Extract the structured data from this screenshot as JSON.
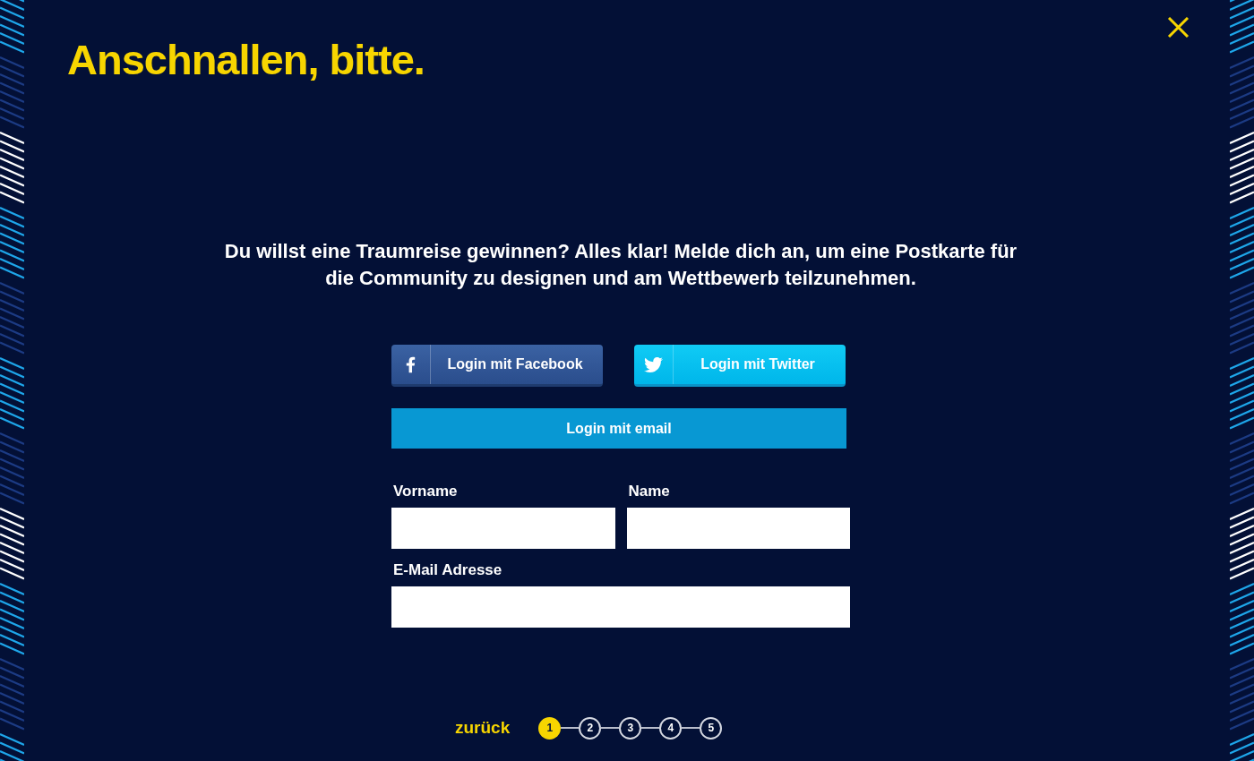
{
  "title": "Anschnallen, bitte.",
  "intro": "Du willst eine Traumreise gewinnen? Alles klar! Melde dich an, um eine Postkarte für die Community zu designen und am Wettbewerb teilzunehmen.",
  "social_buttons": [
    {
      "kind": "facebook",
      "label": "Login mit Facebook"
    },
    {
      "kind": "twitter",
      "label": "Login mit Twitter"
    }
  ],
  "email_button": {
    "label": "Login mit email"
  },
  "form_rows": [
    [
      {
        "label": "Vorname"
      },
      {
        "label": "Name"
      }
    ],
    [
      {
        "label": "E-Mail Adresse"
      }
    ]
  ],
  "back_link": "zurück",
  "steps": [
    {
      "label": "1",
      "selected": true
    },
    {
      "label": "2",
      "selected": false
    },
    {
      "label": "3",
      "selected": false
    },
    {
      "label": "4",
      "selected": false
    },
    {
      "label": "5",
      "selected": false
    }
  ]
}
